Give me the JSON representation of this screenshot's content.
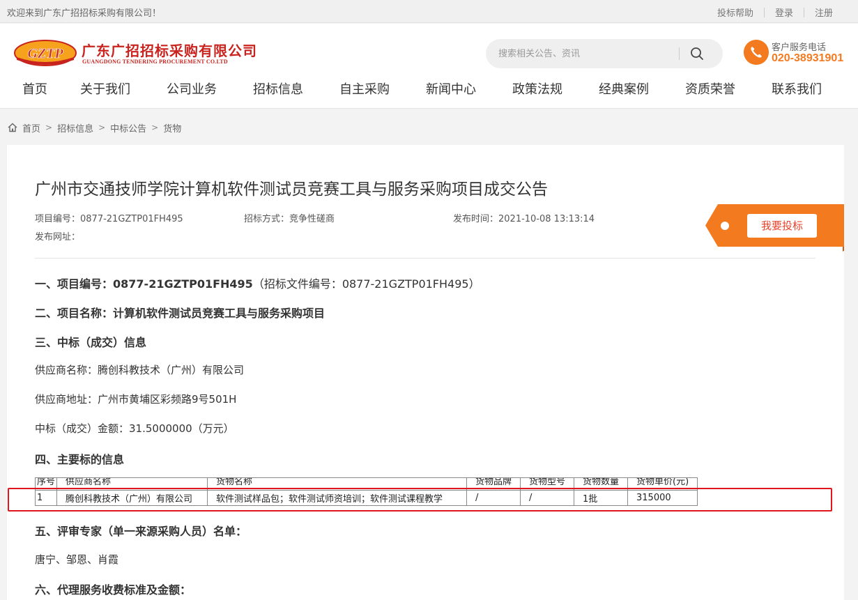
{
  "topbar": {
    "welcome": "欢迎来到广东广招招标采购有限公司！",
    "links": [
      "投标帮助",
      "登录",
      "注册"
    ]
  },
  "header": {
    "logo_badge": "GZTP",
    "company_cn": "广东广招招标采购有限公司",
    "company_en": "GUANGDONG TENDERING PROCUREMENT CO.LTD",
    "search_placeholder": "搜索相关公告、资讯",
    "hotline_label": "客户服务电话",
    "hotline_number": "020-38931901"
  },
  "nav": [
    "首页",
    "关于我们",
    "公司业务",
    "招标信息",
    "自主采购",
    "新闻中心",
    "政策法规",
    "经典案例",
    "资质荣誉",
    "联系我们"
  ],
  "breadcrumb": [
    "首页",
    "招标信息",
    "中标公告",
    "货物"
  ],
  "article": {
    "title": "广州市交通技师学院计算机软件测试员竞赛工具与服务采购项目成交公告",
    "meta": {
      "project_no": "项目编号：0877-21GZTP01FH495",
      "method": "招标方式：竞争性磋商",
      "published": "发布时间：2021-10-08 13:13:14",
      "url_label": "发布网址："
    },
    "bid_button": "我要投标",
    "sec1_label": "一、项目编号：",
    "sec1_value": "0877-21GZTP01FH495",
    "sec1_note": "（招标文件编号：0877-21GZTP01FH495）",
    "sec2": "二、项目名称：计算机软件测试员竞赛工具与服务采购项目",
    "sec3": "三、中标（成交）信息",
    "supplier_name": "供应商名称：腾创科教技术（广州）有限公司",
    "supplier_addr": "供应商地址：广州市黄埔区彩频路9号501H",
    "amount": "中标（成交）金额：31.5000000（万元）",
    "sec4": "四、主要标的信息",
    "table": {
      "headers": [
        "序号",
        "供应商名称",
        "货物名称",
        "货物品牌",
        "货物型号",
        "货物数量",
        "货物单价(元)"
      ],
      "row": [
        "1",
        "腾创科教技术（广州）有限公司",
        "软件测试样品包；软件测试师资培训；软件测试课程教学",
        "/",
        "/",
        "1批",
        "315000"
      ]
    },
    "sec5": "五、评审专家（单一来源采购人员）名单：",
    "experts": "唐宁、邹恩、肖霞",
    "sec6": "六、代理服务收费标准及金额："
  },
  "colors": {
    "brand_red": "#c8231e",
    "accent_orange": "#f37a1f",
    "highlight_red": "#e0161d"
  }
}
